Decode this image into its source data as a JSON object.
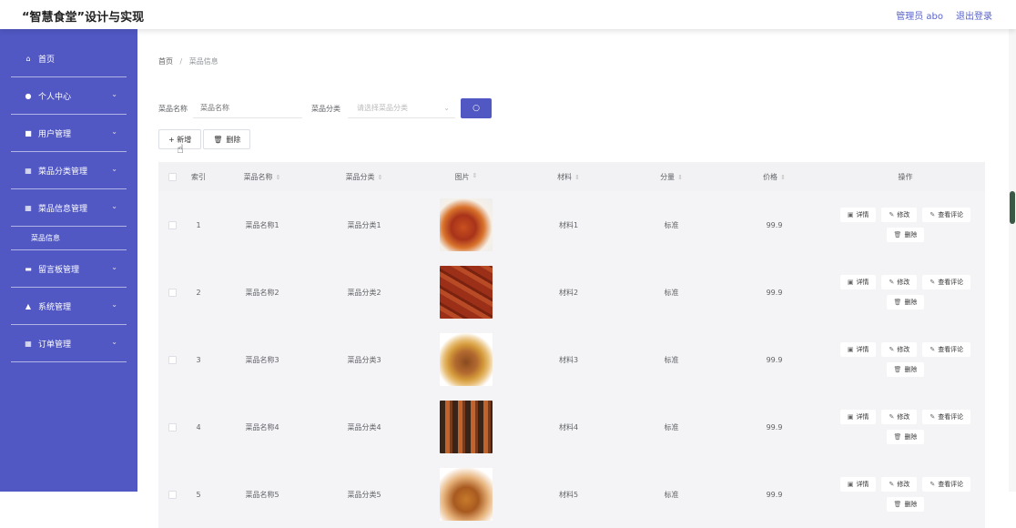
{
  "header": {
    "title": "“智慧食堂”设计与实现",
    "user_label": "管理员 abo",
    "logout_label": "退出登录"
  },
  "sidebar": {
    "items": [
      {
        "label": "首页",
        "icon": "home-icon",
        "glyph": "⌂",
        "has_children": false
      },
      {
        "label": "个人中心",
        "icon": "user-icon",
        "glyph": "●",
        "has_children": true
      },
      {
        "label": "用户管理",
        "icon": "lock-icon",
        "glyph": "■",
        "has_children": true
      },
      {
        "label": "菜品分类管理",
        "icon": "grid-icon",
        "glyph": "▦",
        "has_children": true
      },
      {
        "label": "菜品信息管理",
        "icon": "grid-icon",
        "glyph": "▦",
        "has_children": true,
        "expanded": true
      },
      {
        "label": "菜品信息",
        "submenu": true
      },
      {
        "label": "留言板管理",
        "icon": "board-icon",
        "glyph": "▬",
        "has_children": true
      },
      {
        "label": "系统管理",
        "icon": "person-icon",
        "glyph": "▲",
        "has_children": true
      },
      {
        "label": "订单管理",
        "icon": "grid-icon",
        "glyph": "▦",
        "has_children": true
      }
    ]
  },
  "breadcrumb": {
    "home": "首页",
    "separator": "/",
    "current": "菜品信息"
  },
  "search": {
    "name_label": "菜品名称",
    "name_placeholder": "菜品名称",
    "category_label": "菜品分类",
    "category_placeholder": "请选择菜品分类"
  },
  "actions": {
    "add_label": "+ 新增",
    "delete_label": "删除"
  },
  "table": {
    "headers": [
      "索引",
      "菜品名称",
      "菜品分类",
      "图片",
      "材料",
      "分量",
      "价格",
      "操作"
    ],
    "op_labels": {
      "detail": "详情",
      "edit": "修改",
      "comments": "查看评论",
      "delete": "删除"
    },
    "rows": [
      {
        "index": "1",
        "name": "菜品名称1",
        "category": "菜品分类1",
        "image": "food1",
        "material": "材料1",
        "quantity": "标准",
        "price": "99.9"
      },
      {
        "index": "2",
        "name": "菜品名称2",
        "category": "菜品分类2",
        "image": "food2",
        "material": "材料2",
        "quantity": "标准",
        "price": "99.9"
      },
      {
        "index": "3",
        "name": "菜品名称3",
        "category": "菜品分类3",
        "image": "food3",
        "material": "材料3",
        "quantity": "标准",
        "price": "99.9"
      },
      {
        "index": "4",
        "name": "菜品名称4",
        "category": "菜品分类4",
        "image": "food4",
        "material": "材料4",
        "quantity": "标准",
        "price": "99.9"
      },
      {
        "index": "5",
        "name": "菜品名称5",
        "category": "菜品分类5",
        "image": "food5",
        "material": "材料5",
        "quantity": "标准",
        "price": "99.9"
      }
    ]
  },
  "colors": {
    "accent": "#5158c4",
    "table_bg": "#f4f4f6"
  }
}
